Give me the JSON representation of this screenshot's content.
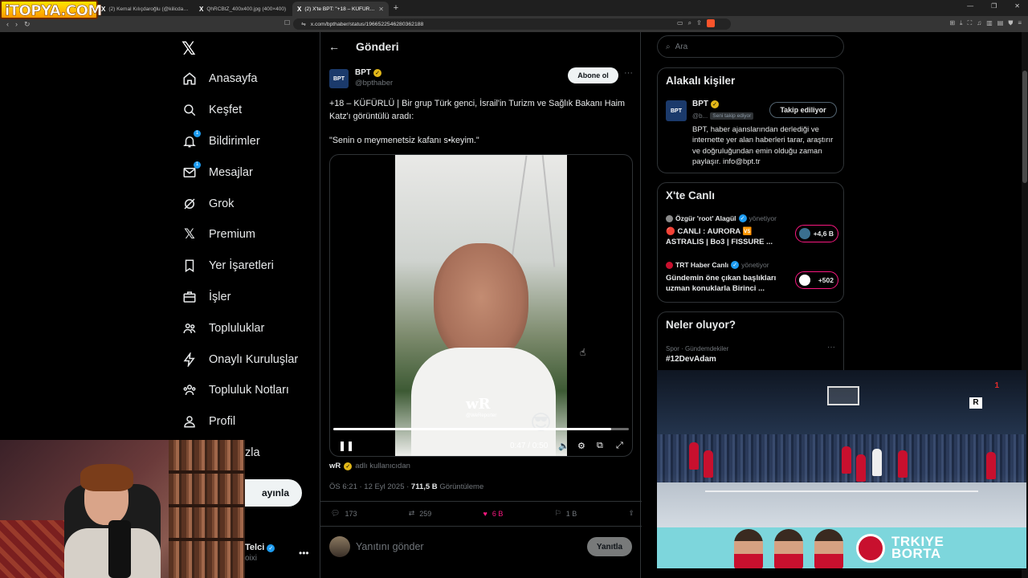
{
  "browser": {
    "tabs": [
      {
        "label": "(2) Kemal Kılıçdaroğlu (@kilicdarogluk...",
        "active": false
      },
      {
        "label": "QhRCBtZ_400x400.jpg (400×400)",
        "active": false
      },
      {
        "label": "(2) X'te BPT: \"+18 – KÜFÜRLÜ | ...",
        "active": true
      }
    ],
    "url": "x.com/bpthaber/status/1966522546280362188",
    "watermark_logo": "iTOPYA.COM"
  },
  "nav": {
    "items": [
      {
        "label": "Anasayfa",
        "icon": "home-icon"
      },
      {
        "label": "Keşfet",
        "icon": "search-icon"
      },
      {
        "label": "Bildirimler",
        "icon": "bell-icon",
        "badge": "1"
      },
      {
        "label": "Mesajlar",
        "icon": "mail-icon",
        "badge": "1"
      },
      {
        "label": "Grok",
        "icon": "grok-icon"
      },
      {
        "label": "Premium",
        "icon": "x-icon"
      },
      {
        "label": "Yer İşaretleri",
        "icon": "bookmark-icon"
      },
      {
        "label": "İşler",
        "icon": "briefcase-icon"
      },
      {
        "label": "Topluluklar",
        "icon": "people-icon"
      },
      {
        "label": "Onaylı Kuruluşlar",
        "icon": "bolt-icon"
      },
      {
        "label": "Topluluk Notları",
        "icon": "community-notes-icon"
      },
      {
        "label": "Profil",
        "icon": "person-icon"
      }
    ],
    "more_partial": "zla",
    "post_partial": "ayınla",
    "account_name_partial": "Telci",
    "account_handle_partial": "oixi"
  },
  "post": {
    "header_title": "Gönderi",
    "author_name": "BPT",
    "author_handle": "@bpthaber",
    "avatar_text": "BPT",
    "subscribe_label": "Abone ol",
    "text": "+18 – KÜFÜRLÜ | Bir grup Türk genci, İsrail'in Turizm ve Sağlık Bakanı Haim Katz'ı görüntülü aradı:",
    "quote": "\"Senin o meymenetsiz kafanı s•keyim.\"",
    "video": {
      "watermark": "wR",
      "watermark_sub": "@WeReporter",
      "time": "0:47 / 0:50",
      "progress": 0.94
    },
    "source_name": "wR",
    "source_suffix": "adlı kullanıcıdan",
    "timestamp": "ÖS 6:21 · 12 Eyl 2025 ·",
    "views_value": "711,5 B",
    "views_label": "Görüntüleme",
    "stats": {
      "replies": "173",
      "reposts": "259",
      "likes": "6 B",
      "bookmarks": "1 B"
    },
    "reply_placeholder": "Yanıtını gönder",
    "reply_button": "Yanıtla"
  },
  "sidebar": {
    "search_placeholder": "Ara",
    "related": {
      "title": "Alakalı kişiler",
      "name": "BPT",
      "handle": "@b...",
      "follows_you": "Seni takip ediyor",
      "follow_label": "Takip ediliyor",
      "bio": "BPT, haber ajanslarından derlediği ve internette yer alan haberleri tarar, araştırır ve doğruluğundan emin olduğu zaman paylaşır. info@bpt.tr"
    },
    "live": {
      "title": "X'te Canlı",
      "items": [
        {
          "host": "Özgür 'root' Alagül",
          "role": "yönetiyor",
          "title": "🔴 CANLI : AURORA 🆚 ASTRALIS | Bo3 | FISSURE ...",
          "count": "+4,6 B"
        },
        {
          "host": "TRT Haber Canlı",
          "role": "yönetiyor",
          "title": "Gündemin öne çıkan başlıkları uzman konuklarla Birinci ...",
          "count": "+502"
        }
      ]
    },
    "trends": {
      "title": "Neler oluyor?",
      "category": "Spor · Gündemdekiler",
      "name": "#12DevAdam"
    }
  },
  "overlay": {
    "channel_logo": "R",
    "channel_number": "1",
    "ad_text_line1": "TRKIYE",
    "ad_text_line2": "BORTA"
  },
  "colors": {
    "background": "#000000",
    "accent": "#1d9bf0",
    "like": "#f91880",
    "gold_verified": "#e2b719"
  }
}
